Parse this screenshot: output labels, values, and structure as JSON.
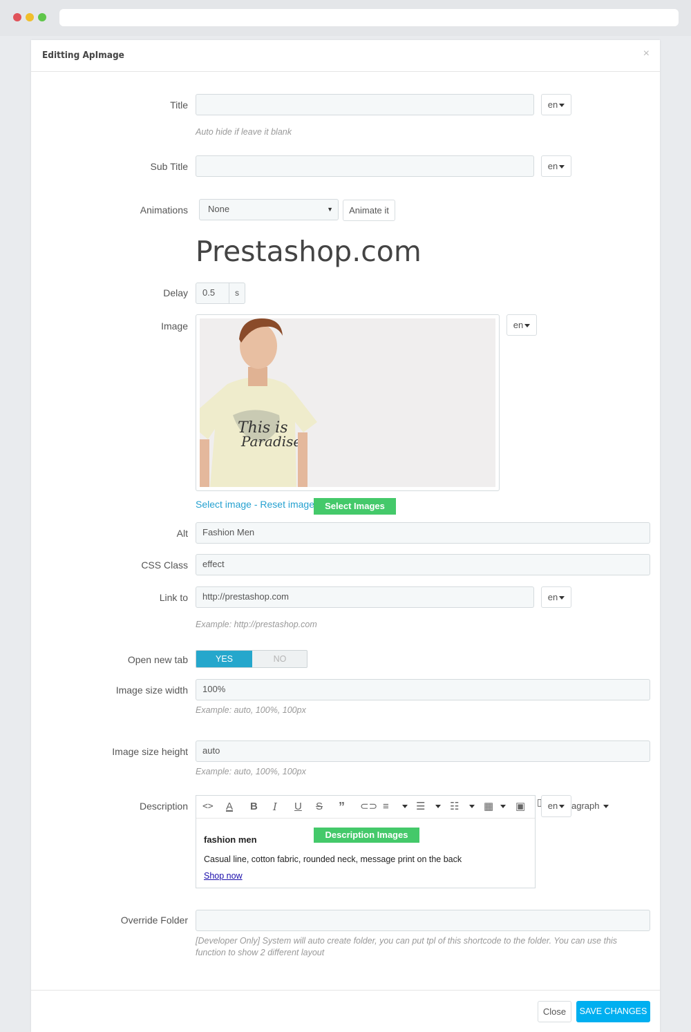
{
  "modal": {
    "title": "Editting ApImage",
    "close_x": "×"
  },
  "fields": {
    "title": {
      "label": "Title",
      "value": "",
      "lang": "en",
      "help": "Auto hide if leave it blank"
    },
    "subtitle": {
      "label": "Sub Title",
      "value": "",
      "lang": "en"
    },
    "animations": {
      "label": "Animations",
      "selected": "None",
      "animate_button": "Animate it",
      "preview_text": "Prestashop.com"
    },
    "delay": {
      "label": "Delay",
      "value": "0.5",
      "unit": "s"
    },
    "image": {
      "label": "Image",
      "lang": "en",
      "select_link": "Select image",
      "separator": " - ",
      "reset_link": "Reset image",
      "tag": "Select Images"
    },
    "alt": {
      "label": "Alt",
      "value": "Fashion Men"
    },
    "css_class": {
      "label": "CSS Class",
      "value": "effect"
    },
    "link_to": {
      "label": "Link to",
      "value": "http://prestashop.com",
      "lang": "en",
      "help": "Example: http://prestashop.com"
    },
    "open_new_tab": {
      "label": "Open new tab",
      "yes": "YES",
      "no": "NO"
    },
    "image_width": {
      "label": "Image size width",
      "value": "100%",
      "help": "Example: auto, 100%, 100px"
    },
    "image_height": {
      "label": "Image size height",
      "value": "auto",
      "help": "Example: auto, 100%, 100px"
    },
    "description": {
      "label": "Description",
      "lang": "en",
      "overflow_text": "agraph",
      "tag": "Description Images",
      "heading": "fashion men",
      "body": "Casual line, cotton fabric, rounded neck, message print on the back",
      "link": "Shop now"
    },
    "override_folder": {
      "label": "Override Folder",
      "value": "",
      "help": "[Developer Only] System will auto create folder, you can put tpl of this shortcode to the folder. You can use this function to show 2 different layout"
    }
  },
  "footer": {
    "close": "Close",
    "save": "SAVE CHANGES"
  },
  "colors": {
    "accent": "#00aff0",
    "toggle_on": "#25a7cc",
    "green_tag": "#44c96a",
    "link": "#25a1d0"
  }
}
